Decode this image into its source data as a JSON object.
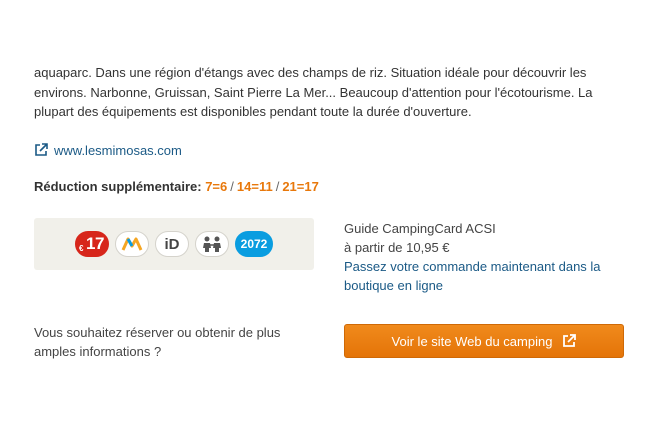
{
  "description": {
    "text": "aquaparc. Dans une région d'étangs avec des champs de riz. Situation idéale pour découvrir les environs. Narbonne, Gruissan, Saint Pierre La Mer... Beaucoup d'attention pour l'écotourisme. La plupart des équipements est disponibles pendant toute la durée d'ouverture."
  },
  "website": {
    "label": "www.lesmimosas.com",
    "icon": "external-link-icon"
  },
  "reduction": {
    "label": "Réduction supplémentaire:",
    "codes": [
      "7=6",
      "14=11",
      "21=17"
    ],
    "separator": "/"
  },
  "badges": {
    "price_badge": {
      "text": "17",
      "currency": "€",
      "color": "#d7261b"
    },
    "logo_badge": {
      "icon": "mountain-m-icon",
      "colors": [
        "#f5a623",
        "#0a9de0"
      ]
    },
    "id_badge": {
      "text": "iD"
    },
    "family_badge": {
      "icon": "family-icon"
    },
    "number_badge": {
      "text": "2072",
      "color": "#0a9de0"
    }
  },
  "guide": {
    "title": "Guide CampingCard ACSI",
    "price": "à partir de 10,95 €",
    "order_link": "Passez votre commande maintenant dans la boutique en ligne"
  },
  "booking": {
    "question": "Vous souhaitez réserver ou obtenir de plus amples informations ?",
    "button_label": "Voir le site Web du camping",
    "button_color": "#e8780b"
  },
  "colors": {
    "link": "#1b5a86",
    "accent": "#e8780b",
    "panel_bg": "#f1f0ea"
  }
}
